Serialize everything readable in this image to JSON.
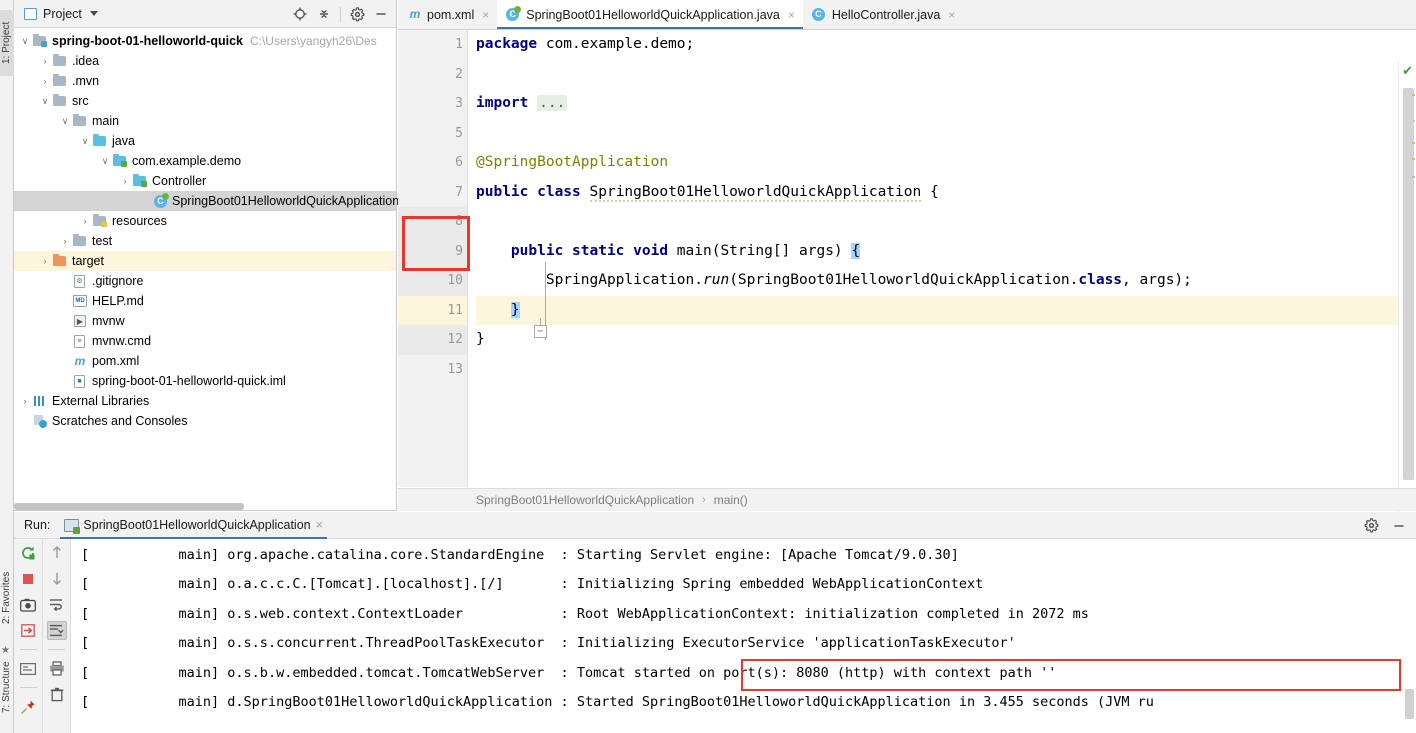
{
  "left_rail": {
    "items": [
      {
        "label": "1: Project",
        "active": true
      },
      {
        "label": "2: Favorites",
        "active": false
      },
      {
        "label": "7: Structure",
        "active": false
      }
    ]
  },
  "project_panel": {
    "title": "Project",
    "tools": [
      {
        "name": "locate-icon",
        "glyph": "⊕"
      },
      {
        "name": "collapse-all-icon",
        "glyph": "≡"
      },
      {
        "name": "gear-icon",
        "glyph": "⚙"
      },
      {
        "name": "minimize-icon",
        "glyph": "—"
      }
    ],
    "tree": [
      {
        "label": "spring-boot-01-helloworld-quick",
        "path": "C:\\Users\\yangyh26\\Des",
        "indent": 0,
        "arrow": "∨",
        "icon": "module-folder",
        "bold": true
      },
      {
        "label": ".idea",
        "indent": 1,
        "arrow": "›",
        "icon": "folder"
      },
      {
        "label": ".mvn",
        "indent": 1,
        "arrow": "›",
        "icon": "folder"
      },
      {
        "label": "src",
        "indent": 1,
        "arrow": "∨",
        "icon": "folder"
      },
      {
        "label": "main",
        "indent": 2,
        "arrow": "∨",
        "icon": "folder"
      },
      {
        "label": "java",
        "indent": 3,
        "arrow": "∨",
        "icon": "source-folder"
      },
      {
        "label": "com.example.demo",
        "indent": 4,
        "arrow": "∨",
        "icon": "package"
      },
      {
        "label": "Controller",
        "indent": 5,
        "arrow": "›",
        "icon": "package"
      },
      {
        "label": "SpringBoot01HelloworldQuickApplication",
        "indent": 6,
        "arrow": "",
        "icon": "spring-class",
        "selected": true
      },
      {
        "label": "resources",
        "indent": 3,
        "arrow": "›",
        "icon": "resources-folder"
      },
      {
        "label": "test",
        "indent": 2,
        "arrow": "›",
        "icon": "folder"
      },
      {
        "label": "target",
        "indent": 1,
        "arrow": "›",
        "icon": "target-folder",
        "highlight": true
      },
      {
        "label": ".gitignore",
        "indent": 2,
        "arrow": "",
        "icon": "git-file"
      },
      {
        "label": "HELP.md",
        "indent": 2,
        "arrow": "",
        "icon": "md-file"
      },
      {
        "label": "mvnw",
        "indent": 2,
        "arrow": "",
        "icon": "exec-file"
      },
      {
        "label": "mvnw.cmd",
        "indent": 2,
        "arrow": "",
        "icon": "cmd-file"
      },
      {
        "label": "pom.xml",
        "indent": 2,
        "arrow": "",
        "icon": "maven-file"
      },
      {
        "label": "spring-boot-01-helloworld-quick.iml",
        "indent": 2,
        "arrow": "",
        "icon": "iml-file"
      },
      {
        "label": "External Libraries",
        "indent": 0,
        "arrow": "›",
        "icon": "libraries"
      },
      {
        "label": "Scratches and Consoles",
        "indent": 0,
        "arrow": "",
        "icon": "scratches"
      }
    ]
  },
  "editor": {
    "tabs": [
      {
        "label": "pom.xml",
        "icon": "maven-icon",
        "active": false,
        "closable": true
      },
      {
        "label": "SpringBoot01HelloworldQuickApplication.java",
        "icon": "spring-class-icon",
        "active": true,
        "closable": true
      },
      {
        "label": "HelloController.java",
        "icon": "class-icon",
        "active": false,
        "closable": true
      }
    ],
    "line_numbers": [
      "1",
      "2",
      "3",
      "5",
      "6",
      "7",
      "8",
      "9",
      "10",
      "11",
      "12",
      "13"
    ],
    "code_lines": [
      "package com.example.demo;",
      "",
      "import ...",
      "",
      "@SpringBootApplication",
      "public class SpringBoot01HelloworldQuickApplication {",
      "",
      "    public static void main(String[] args) {",
      "        SpringApplication.run(SpringBoot01HelloworldQuickApplication.class, args);",
      "    }",
      "}",
      ""
    ],
    "breadcrumb": {
      "class": "SpringBoot01HelloworldQuickApplication",
      "separator": "›",
      "method": "main()"
    },
    "inspection_status": "✔"
  },
  "run_panel": {
    "label": "Run:",
    "tab_label": "SpringBoot01HelloworldQuickApplication",
    "tab_close": "×",
    "header_tools": [
      {
        "name": "gear-icon",
        "glyph": "⚙"
      },
      {
        "name": "minimize-icon",
        "glyph": "—"
      }
    ],
    "toolbar_left": [
      {
        "name": "rerun-icon",
        "glyph": "↻",
        "color": "#3f9e3f"
      },
      {
        "name": "stop-icon",
        "glyph": "■",
        "color": "#e05252"
      },
      {
        "name": "screenshot-icon",
        "glyph": "▣",
        "color": "#4a4a4a"
      },
      {
        "name": "thread-dump-icon",
        "glyph": "⇥",
        "color": "#d45252"
      },
      {
        "name": "console-icon",
        "glyph": "⌸",
        "color": "#6b6b6b"
      },
      {
        "name": "pin-icon",
        "glyph": "✒",
        "color": "#c0392b"
      }
    ],
    "toolbar_right": [
      {
        "name": "scroll-up-icon",
        "glyph": "↑",
        "color": "#9a9a9a"
      },
      {
        "name": "scroll-down-icon",
        "glyph": "↓",
        "color": "#9a9a9a"
      },
      {
        "name": "soft-wrap-icon",
        "glyph": "↵",
        "color": "#5a5a5a"
      },
      {
        "name": "scroll-to-end-icon",
        "glyph": "↧",
        "color": "#5a5a5a",
        "selected": true
      },
      {
        "name": "print-icon",
        "glyph": "⎙",
        "color": "#5a5a5a"
      },
      {
        "name": "clear-all-icon",
        "glyph": "Ὕ1",
        "color": "#5a5a5a"
      }
    ],
    "log_lines": [
      {
        "thread": "[           main]",
        "logger": "org.apache.catalina.core.StandardEngine",
        "sep": ":",
        "message": "Starting Servlet engine: [Apache Tomcat/9.0.30]",
        "highlight": false
      },
      {
        "thread": "[           main]",
        "logger": "o.a.c.c.C.[Tomcat].[localhost].[/]",
        "sep": ":",
        "message": "Initializing Spring embedded WebApplicationContext",
        "highlight": false
      },
      {
        "thread": "[           main]",
        "logger": "o.s.web.context.ContextLoader",
        "sep": ":",
        "message": "Root WebApplicationContext: initialization completed in 2072 ms",
        "highlight": false
      },
      {
        "thread": "[           main]",
        "logger": "o.s.s.concurrent.ThreadPoolTaskExecutor",
        "sep": ":",
        "message": "Initializing ExecutorService 'applicationTaskExecutor'",
        "highlight": false
      },
      {
        "thread": "[           main]",
        "logger": "o.s.b.w.embedded.tomcat.TomcatWebServer",
        "sep": ":",
        "message": "Tomcat started on port(s): 8080 (http) with context path ''",
        "highlight": true
      },
      {
        "thread": "[           main]",
        "logger": "d.SpringBoot01HelloworldQuickApplication",
        "sep": ":",
        "message": "Started SpringBoot01HelloworldQuickApplication in 3.455 seconds (JVM ru",
        "highlight": false
      }
    ]
  },
  "colors": {
    "accent_blue": "#3c73b4",
    "annotation_red": "#e8382b",
    "spring_green": "#6db33f",
    "keyword_navy": "#000080",
    "annotation_olive": "#808000",
    "selection_blue": "#a6d2ff",
    "current_line": "#fdf6dd"
  }
}
